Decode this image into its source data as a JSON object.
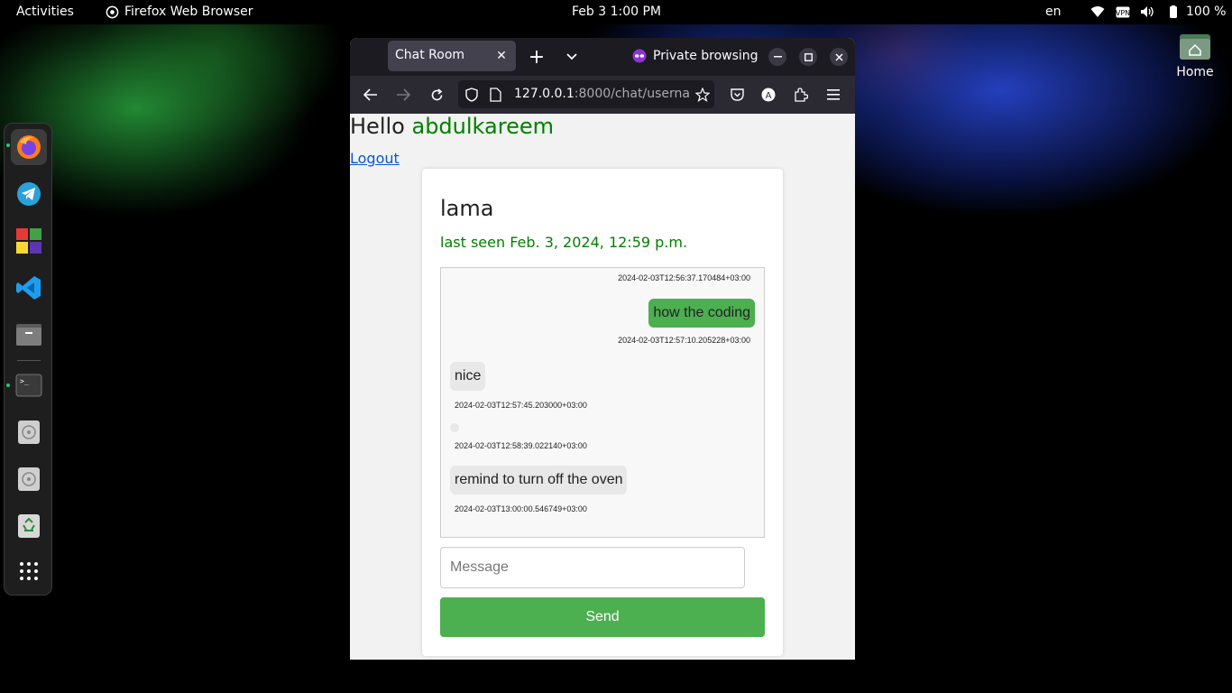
{
  "topbar": {
    "activities": "Activities",
    "app_name": "Firefox Web Browser",
    "datetime": "Feb 3   1:00 PM",
    "lang": "en",
    "battery": "100 %"
  },
  "desktop": {
    "home_label": "Home"
  },
  "dock": {
    "apps": [
      "firefox",
      "telegram",
      "app-grid-colored",
      "vscode",
      "files",
      "terminal",
      "disc-drive-1",
      "disc-drive-2",
      "trash",
      "show-applications"
    ]
  },
  "browser": {
    "tab_title": "Chat Room",
    "private_label": "Private browsing",
    "url_host": "127.0.0.1",
    "url_rest": ":8000/chat/userna"
  },
  "page": {
    "hello_prefix": "Hello",
    "username": "abdulkareem",
    "logout": "Logout",
    "peer_name": "lama",
    "last_seen": "last seen Feb. 3, 2024, 12:59 p.m.",
    "message_placeholder": "Message",
    "send_label": "Send"
  },
  "messages": [
    {
      "side": "sent",
      "text": "",
      "timestamp": "2024-02-03T12:56:37.170484+03:00"
    },
    {
      "side": "sent",
      "text": "how the coding",
      "timestamp": "2024-02-03T12:57:10.205228+03:00"
    },
    {
      "side": "recv",
      "text": "nice",
      "timestamp": "2024-02-03T12:57:45.203000+03:00"
    },
    {
      "side": "recv",
      "text": "",
      "timestamp": "2024-02-03T12:58:39.022140+03:00"
    },
    {
      "side": "recv",
      "text": "remind to turn off the oven",
      "timestamp": "2024-02-03T13:00:00.546749+03:00"
    }
  ],
  "colors": {
    "accent_green": "#4caf50",
    "username_green": "#008000",
    "link_blue": "#0a58ca"
  }
}
